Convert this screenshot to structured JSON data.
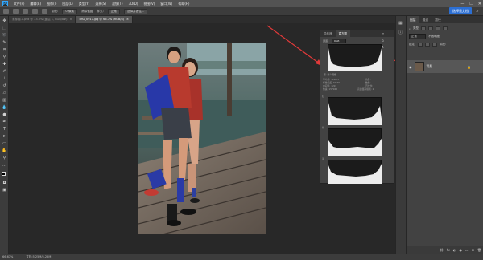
{
  "menu": {
    "logo": "Ps",
    "items": [
      "文件(F)",
      "编辑(E)",
      "图像(I)",
      "图层(L)",
      "类型(Y)",
      "选择(S)",
      "滤镜(T)",
      "3D(D)",
      "视图(V)",
      "窗口(W)",
      "帮助(H)"
    ]
  },
  "window_controls": {
    "minimize": "—",
    "restore": "❐",
    "close": "✕"
  },
  "options": {
    "mode_label": "羽化:",
    "feather_value": "0 像素",
    "refine_label": "消除锯齿",
    "style_label": "样式:",
    "style_value": "正常",
    "select_mask": "选择并遮住..."
  },
  "cloud_button": "选择云文档",
  "tabs": [
    {
      "label": "未标题-1.psd @ 33.3% (图层 1, RGB/8#)",
      "close": "×"
    },
    {
      "label": "IMG_0917.jpg @ 66.7% (RGB/8)",
      "close": "×"
    }
  ],
  "histogram": {
    "tabs": [
      "导航器",
      "直方图"
    ],
    "channel_label": "通道:",
    "channel_value": "RGB",
    "stats_left": [
      "平均值: 126.73",
      "标准偏差: 67.66",
      "中间值: 129",
      "像素: 157940"
    ],
    "stats_right": [
      "色阶:",
      "数量:",
      "百分位:",
      "高速缓存级别: 2"
    ],
    "channels": [
      "红",
      "绿",
      "蓝"
    ]
  },
  "right_panel": {
    "tabs": [
      "图层",
      "通道",
      "路径"
    ],
    "filter_label": "类型",
    "blend_mode": "正常",
    "opacity_label": "不透明度:",
    "lock_label": "锁定:",
    "fill_label": "填充:",
    "layer_name": "背景"
  },
  "status": {
    "zoom": "66.67%",
    "doc_info": "文档:5.25M/5.25M"
  }
}
